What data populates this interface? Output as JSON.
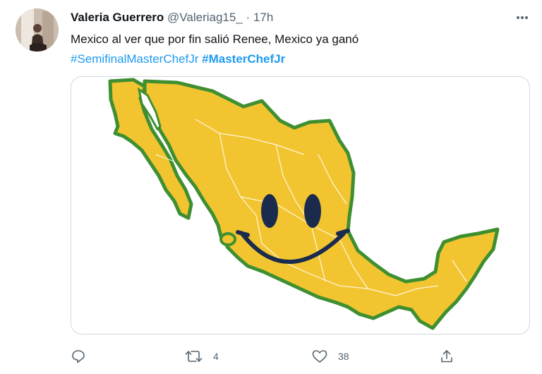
{
  "tweet": {
    "author_name": "Valeria Guerrero",
    "handle": "@Valeriag15_",
    "separator": "·",
    "time": "17h",
    "text": "Mexico al ver que por fin salió Renee, Mexico ya ganó",
    "hashtag_1": "#SemifinalMasterChefJr",
    "hashtag_2": "#MasterChefJr",
    "media_description_icon": "map-of-mexico-smiley",
    "reply_count": "",
    "retweet_count": "4",
    "like_count": "38"
  },
  "icons": {
    "more": "more-icon",
    "reply": "reply-icon",
    "retweet": "retweet-icon",
    "like": "like-icon",
    "share": "share-icon"
  },
  "colors": {
    "map_fill": "#f2c530",
    "map_border": "#3f8f31",
    "hashtag": "#1d9bf0",
    "secondary_text": "#536471",
    "face": "#1a2b4d"
  }
}
